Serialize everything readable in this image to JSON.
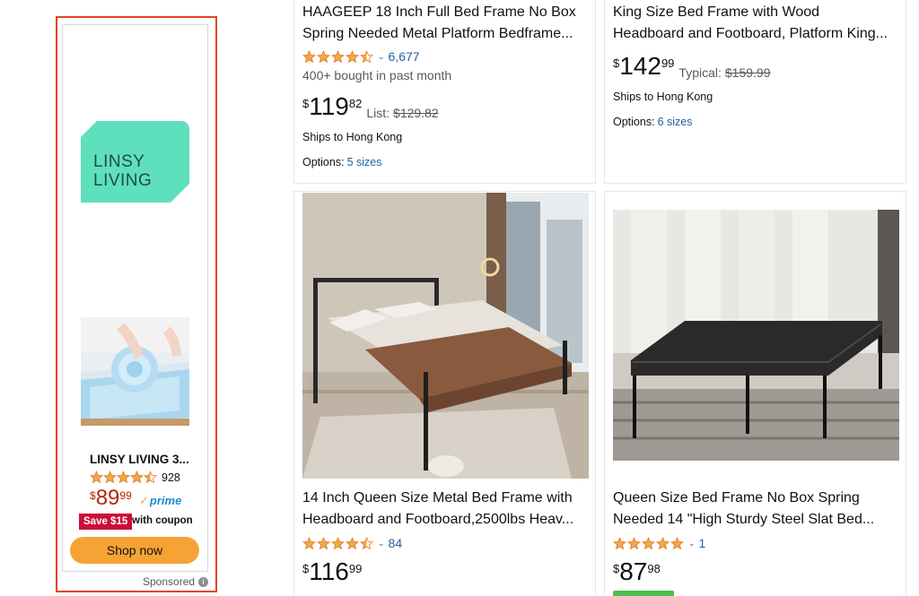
{
  "ad": {
    "brand_logo_text_line1": "LINSY",
    "brand_logo_text_line2": "LIVING",
    "product_title": "LINSY LIVING 3...",
    "rating_count": "928",
    "price_dollar": "$",
    "price_whole": "89",
    "price_cents": "99",
    "prime_label": "prime",
    "coupon_tag": "Save $15",
    "coupon_text": "with coupon",
    "shop_button": "Shop now",
    "sponsored_label": "Sponsored",
    "rating_stars": 4.5,
    "colors": {
      "accent": "#f4a334",
      "price": "#b12704",
      "coupon": "#cc0c39",
      "prime": "#1f8ccb",
      "outline": "#e5422b",
      "logo_bg": "#5ee0bd"
    }
  },
  "products": [
    {
      "title_line1": "HAAGEEP 18 Inch Full Bed Frame No Box",
      "title_line2": "Spring Needed Metal Platform Bedframe...",
      "rating_stars": 4.5,
      "rating_count": "6,677",
      "bought": "400+ bought in past month",
      "price_dollar": "$",
      "price_whole": "119",
      "price_cents": "82",
      "ref_label": "List:",
      "ref_price": "$129.82",
      "ships": "Ships to Hong Kong",
      "options_label": "Options:",
      "options_link": "5 sizes"
    },
    {
      "title_line1": "King Size Bed Frame with Wood",
      "title_line2": "Headboard and Footboard, Platform King...",
      "price_dollar": "$",
      "price_whole": "142",
      "price_cents": "99",
      "ref_label": "Typical:",
      "ref_price": "$159.99",
      "ships": "Ships to Hong Kong",
      "options_label": "Options:",
      "options_link": "6 sizes"
    },
    {
      "title_line1": "14 Inch Queen Size Metal Bed Frame with",
      "title_line2": "Headboard and Footboard,2500lbs Heav...",
      "rating_stars": 4.5,
      "rating_count": "84",
      "price_dollar": "$",
      "price_whole": "116",
      "price_cents": "99"
    },
    {
      "title_line1": "Queen Size Bed Frame No Box Spring",
      "title_line2": "Needed 14 \"High Sturdy Steel Slat Bed...",
      "rating_stars": 5,
      "rating_count": "1",
      "price_dollar": "$",
      "price_whole": "87",
      "price_cents": "98"
    }
  ],
  "icons": {
    "star": "star-icon",
    "chevron": "chevron-down-icon",
    "info": "info-icon"
  },
  "star_color": "#f3a847"
}
